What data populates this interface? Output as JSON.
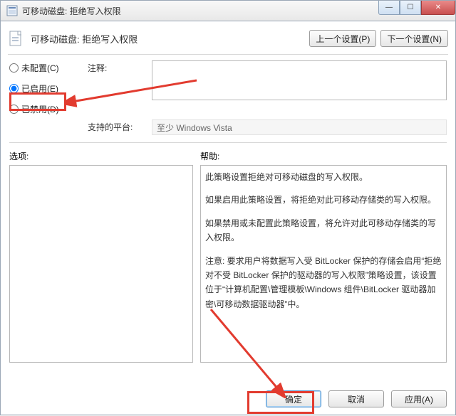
{
  "window": {
    "title": "可移动磁盘: 拒绝写入权限"
  },
  "header": {
    "policy_title": "可移动磁盘: 拒绝写入权限",
    "prev_setting": "上一个设置(P)",
    "next_setting": "下一个设置(N)"
  },
  "radios": {
    "not_configured": "未配置(C)",
    "enabled": "已启用(E)",
    "disabled": "已禁用(D)"
  },
  "labels": {
    "comment": "注释:",
    "supported": "支持的平台:",
    "options": "选项:",
    "help": "帮助:"
  },
  "supported_text": "至少 Windows Vista",
  "help_paragraphs": [
    "此策略设置拒绝对可移动磁盘的写入权限。",
    "如果启用此策略设置，将拒绝对此可移动存储类的写入权限。",
    "如果禁用或未配置此策略设置，将允许对此可移动存储类的写入权限。",
    "注意: 要求用户将数据写入受 BitLocker 保护的存储会启用“拒绝对不受 BitLocker 保护的驱动器的写入权限”策略设置，该设置位于“计算机配置\\管理模板\\Windows 组件\\BitLocker 驱动器加密\\可移动数据驱动器”中。"
  ],
  "footer": {
    "ok": "确定",
    "cancel": "取消",
    "apply": "应用(A)"
  }
}
